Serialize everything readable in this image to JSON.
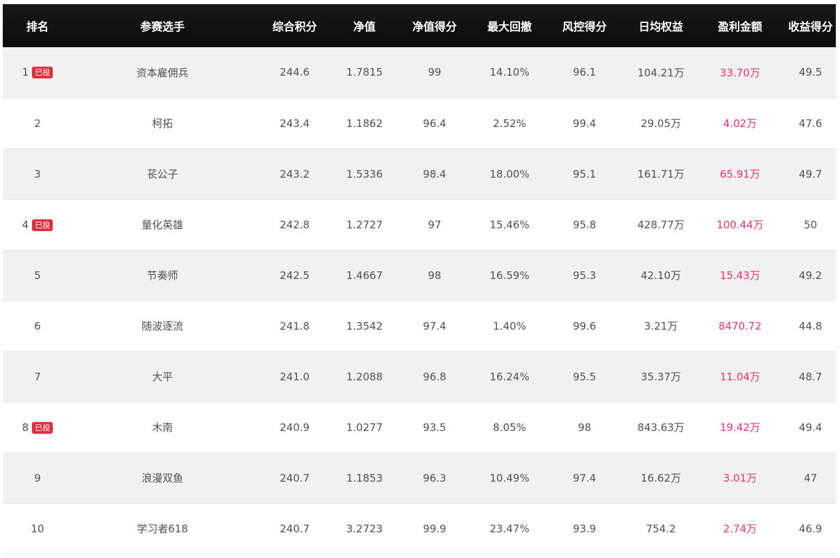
{
  "table": {
    "headers": [
      "排名",
      "参赛选手",
      "综合积分",
      "净值",
      "净值得分",
      "最大回撤",
      "风控得分",
      "日均权益",
      "盈利金额",
      "收益得分"
    ],
    "rows": [
      {
        "rank": "1",
        "badge": "已投",
        "name": "资本雇佣兵",
        "score": "244.6",
        "nav": "1.7815",
        "nav_score": "99",
        "drawdown": "14.10%",
        "risk_score": "96.1",
        "avg_equity": "104.21万",
        "profit": "33.70万",
        "return_score": "49.5"
      },
      {
        "rank": "2",
        "badge": "",
        "name": "柯拓",
        "score": "243.4",
        "nav": "1.1862",
        "nav_score": "96.4",
        "drawdown": "2.52%",
        "risk_score": "99.4",
        "avg_equity": "29.05万",
        "profit": "4.02万",
        "return_score": "47.6"
      },
      {
        "rank": "3",
        "badge": "",
        "name": "苌公子",
        "score": "243.2",
        "nav": "1.5336",
        "nav_score": "98.4",
        "drawdown": "18.00%",
        "risk_score": "95.1",
        "avg_equity": "161.71万",
        "profit": "65.91万",
        "return_score": "49.7"
      },
      {
        "rank": "4",
        "badge": "已投",
        "name": "量化英雄",
        "score": "242.8",
        "nav": "1.2727",
        "nav_score": "97",
        "drawdown": "15.46%",
        "risk_score": "95.8",
        "avg_equity": "428.77万",
        "profit": "100.44万",
        "return_score": "50"
      },
      {
        "rank": "5",
        "badge": "",
        "name": "节奏师",
        "score": "242.5",
        "nav": "1.4667",
        "nav_score": "98",
        "drawdown": "16.59%",
        "risk_score": "95.3",
        "avg_equity": "42.10万",
        "profit": "15.43万",
        "return_score": "49.2"
      },
      {
        "rank": "6",
        "badge": "",
        "name": "随波逐流",
        "score": "241.8",
        "nav": "1.3542",
        "nav_score": "97.4",
        "drawdown": "1.40%",
        "risk_score": "99.6",
        "avg_equity": "3.21万",
        "profit": "8470.72",
        "return_score": "44.8"
      },
      {
        "rank": "7",
        "badge": "",
        "name": "大平",
        "score": "241.0",
        "nav": "1.2088",
        "nav_score": "96.8",
        "drawdown": "16.24%",
        "risk_score": "95.5",
        "avg_equity": "35.37万",
        "profit": "11.04万",
        "return_score": "48.7"
      },
      {
        "rank": "8",
        "badge": "已投",
        "name": "木南",
        "score": "240.9",
        "nav": "1.0277",
        "nav_score": "93.5",
        "drawdown": "8.05%",
        "risk_score": "98",
        "avg_equity": "843.63万",
        "profit": "19.42万",
        "return_score": "49.4"
      },
      {
        "rank": "9",
        "badge": "",
        "name": "浪漫双鱼",
        "score": "240.7",
        "nav": "1.1853",
        "nav_score": "96.3",
        "drawdown": "10.49%",
        "risk_score": "97.4",
        "avg_equity": "16.62万",
        "profit": "3.01万",
        "return_score": "47"
      },
      {
        "rank": "10",
        "badge": "",
        "name": "学习者618",
        "score": "240.7",
        "nav": "3.2723",
        "nav_score": "99.9",
        "drawdown": "23.47%",
        "risk_score": "93.9",
        "avg_equity": "754.2",
        "profit": "2.74万",
        "return_score": "46.9"
      }
    ]
  },
  "colors": {
    "header_bg": "#111111",
    "profit_text": "#e8336d",
    "badge_bg": "#de3041",
    "odd_row": "#f1f1f1"
  }
}
